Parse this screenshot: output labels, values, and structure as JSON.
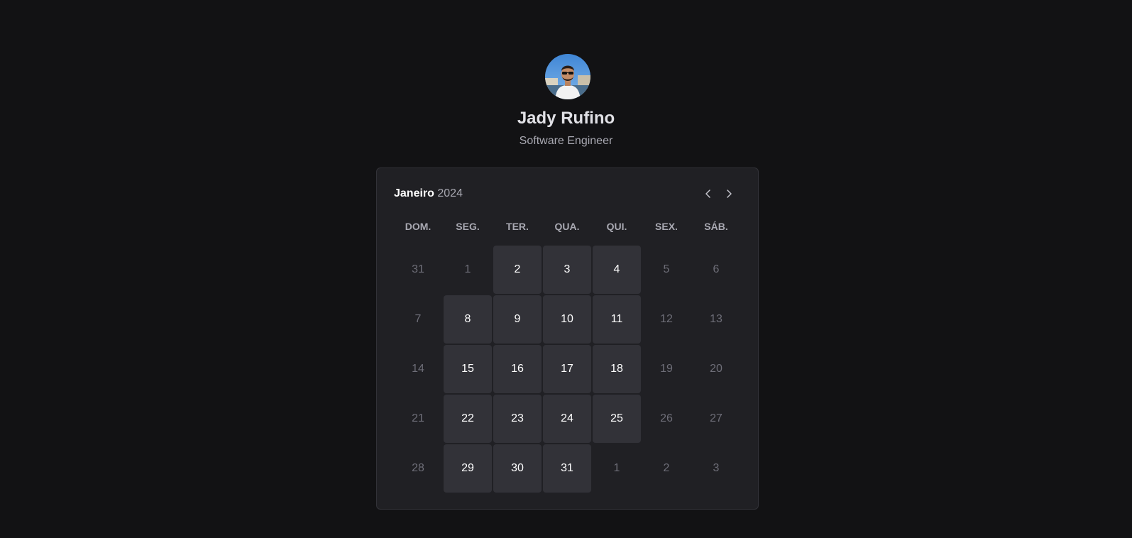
{
  "profile": {
    "name": "Jady Rufino",
    "role": "Software Engineer"
  },
  "calendar": {
    "month": "Janeiro",
    "year": "2024",
    "prev_icon": "chevron-left-icon",
    "next_icon": "chevron-right-icon",
    "weekdays": [
      "DOM.",
      "SEG.",
      "TER.",
      "QUA.",
      "QUI.",
      "SEX.",
      "SÁB."
    ],
    "weeks": [
      [
        {
          "label": "31",
          "available": false
        },
        {
          "label": "1",
          "available": false
        },
        {
          "label": "2",
          "available": true
        },
        {
          "label": "3",
          "available": true
        },
        {
          "label": "4",
          "available": true
        },
        {
          "label": "5",
          "available": false
        },
        {
          "label": "6",
          "available": false
        }
      ],
      [
        {
          "label": "7",
          "available": false
        },
        {
          "label": "8",
          "available": true
        },
        {
          "label": "9",
          "available": true
        },
        {
          "label": "10",
          "available": true
        },
        {
          "label": "11",
          "available": true
        },
        {
          "label": "12",
          "available": false
        },
        {
          "label": "13",
          "available": false
        }
      ],
      [
        {
          "label": "14",
          "available": false
        },
        {
          "label": "15",
          "available": true
        },
        {
          "label": "16",
          "available": true
        },
        {
          "label": "17",
          "available": true
        },
        {
          "label": "18",
          "available": true
        },
        {
          "label": "19",
          "available": false
        },
        {
          "label": "20",
          "available": false
        }
      ],
      [
        {
          "label": "21",
          "available": false
        },
        {
          "label": "22",
          "available": true
        },
        {
          "label": "23",
          "available": true
        },
        {
          "label": "24",
          "available": true
        },
        {
          "label": "25",
          "available": true
        },
        {
          "label": "26",
          "available": false
        },
        {
          "label": "27",
          "available": false
        }
      ],
      [
        {
          "label": "28",
          "available": false
        },
        {
          "label": "29",
          "available": true
        },
        {
          "label": "30",
          "available": true
        },
        {
          "label": "31",
          "available": true
        },
        {
          "label": "1",
          "available": false
        },
        {
          "label": "2",
          "available": false
        },
        {
          "label": "3",
          "available": false
        }
      ]
    ]
  },
  "colors": {
    "background": "#121214",
    "card": "#202024",
    "available_day": "#323238",
    "text": "#e1e1e6",
    "muted": "#a9a9b2"
  }
}
